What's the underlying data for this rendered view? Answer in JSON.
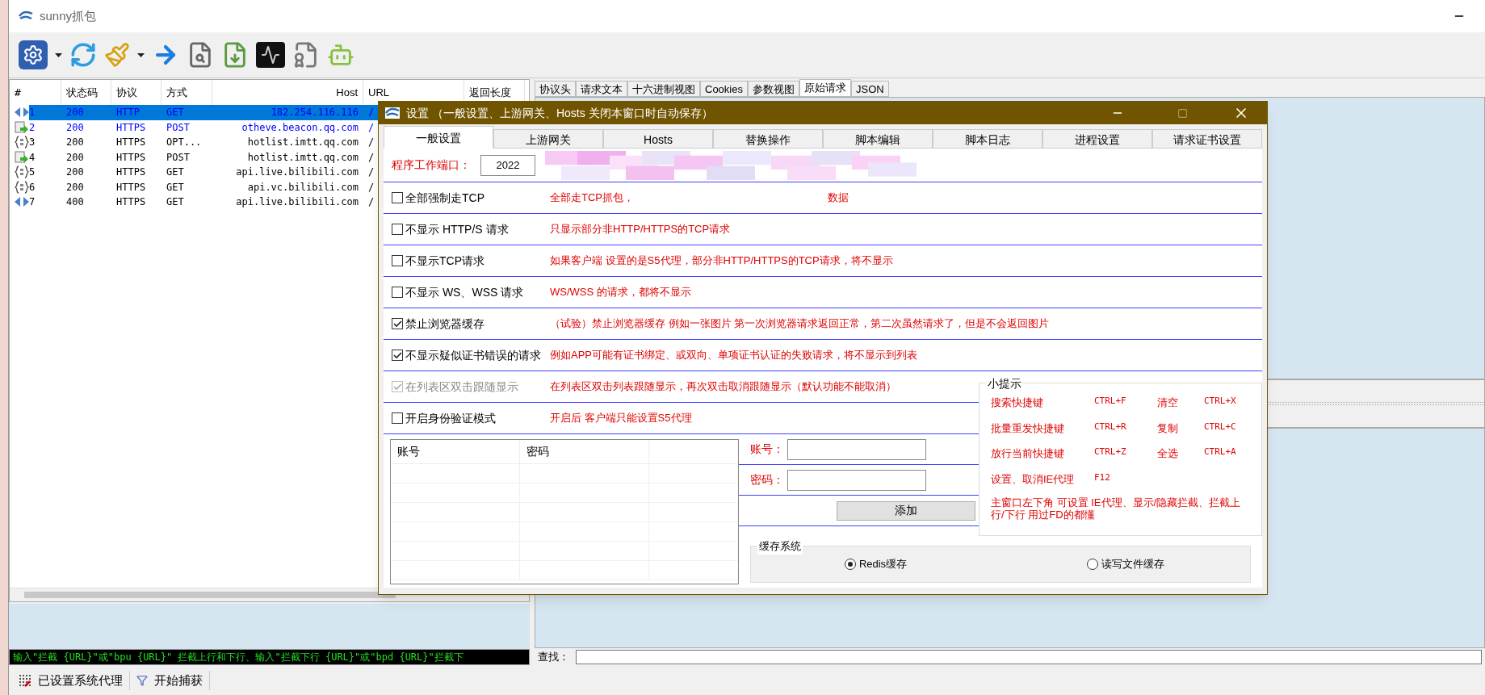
{
  "window": {
    "title": "sunny抓包"
  },
  "list": {
    "columns": [
      "#",
      "状态码",
      "协议",
      "方式",
      "Host",
      "URL",
      "返回长度"
    ],
    "rows": [
      {
        "kind": "websocket",
        "num": "1",
        "status": "200",
        "protocol": "HTTP",
        "method": "GET",
        "host": "182.254.116.116",
        "url": "/",
        "selected": true,
        "highlighted": true
      },
      {
        "kind": "file",
        "num": "2",
        "status": "200",
        "protocol": "HTTPS",
        "method": "POST",
        "host": "otheve.beacon.qq.com",
        "url": "/",
        "selected": false,
        "highlighted": true
      },
      {
        "kind": "json",
        "num": "3",
        "status": "200",
        "protocol": "HTTPS",
        "method": "OPT...",
        "host": "hotlist.imtt.qq.com",
        "url": "/",
        "selected": false,
        "highlighted": false
      },
      {
        "kind": "file",
        "num": "4",
        "status": "200",
        "protocol": "HTTPS",
        "method": "POST",
        "host": "hotlist.imtt.qq.com",
        "url": "/",
        "selected": false,
        "highlighted": false
      },
      {
        "kind": "json",
        "num": "5",
        "status": "200",
        "protocol": "HTTPS",
        "method": "GET",
        "host": "api.live.bilibili.com",
        "url": "/",
        "selected": false,
        "highlighted": false
      },
      {
        "kind": "json",
        "num": "6",
        "status": "200",
        "protocol": "HTTPS",
        "method": "GET",
        "host": "api.vc.bilibili.com",
        "url": "/",
        "selected": false,
        "highlighted": false
      },
      {
        "kind": "websocket",
        "num": "7",
        "status": "400",
        "protocol": "HTTPS",
        "method": "GET",
        "host": "api.live.bilibili.com",
        "url": "/",
        "selected": false,
        "highlighted": false
      }
    ]
  },
  "detail_tabs": [
    {
      "label": "协议头",
      "selected": false
    },
    {
      "label": "请求文本",
      "selected": false
    },
    {
      "label": "十六进制视图",
      "selected": false
    },
    {
      "label": "Cookies",
      "selected": false
    },
    {
      "label": "参数视图",
      "selected": false
    },
    {
      "label": "原始请求",
      "selected": true
    },
    {
      "label": "JSON",
      "selected": false
    }
  ],
  "command_line": "输入\"拦截 {URL}\"或\"bpu {URL}\" 拦截上行和下行、输入\"拦截下行 {URL}\"或\"bpd {URL}\"拦截下",
  "search": {
    "label": "查找："
  },
  "status_bar": [
    {
      "label": "已设置系统代理"
    },
    {
      "label": "开始捕获"
    }
  ],
  "dialog": {
    "title": "设置 （一般设置、上游网关、Hosts 关闭本窗口时自动保存）",
    "tabs": [
      {
        "label": "一般设置",
        "selected": true
      },
      {
        "label": "上游网关",
        "selected": false
      },
      {
        "label": "Hosts",
        "selected": false
      },
      {
        "label": "替换操作",
        "selected": false
      },
      {
        "label": "脚本编辑",
        "selected": false
      },
      {
        "label": "脚本日志",
        "selected": false
      },
      {
        "label": "进程设置",
        "selected": false
      },
      {
        "label": "请求证书设置",
        "selected": false
      }
    ],
    "port": {
      "label": "程序工作端口：",
      "value": "2022"
    },
    "options": [
      {
        "label": "全部强制走TCP",
        "checked": false,
        "disabled": false,
        "description": "全部走TCP抓包，",
        "description_end": "数据"
      },
      {
        "label": "不显示 HTTP/S 请求",
        "checked": false,
        "disabled": false,
        "description": "只显示部分非HTTP/HTTPS的TCP请求"
      },
      {
        "label": "不显示TCP请求",
        "checked": false,
        "disabled": false,
        "description": "如果客户端 设置的是S5代理，部分非HTTP/HTTPS的TCP请求，将不显示"
      },
      {
        "label": "不显示 WS、WSS 请求",
        "checked": false,
        "disabled": false,
        "description": "WS/WSS 的请求，都将不显示"
      },
      {
        "label": "禁止浏览器缓存",
        "checked": true,
        "disabled": false,
        "description": "（试验）禁止浏览器缓存 例如一张图片 第一次浏览器请求返回正常，第二次虽然请求了，但是不会返回图片"
      },
      {
        "label": "不显示疑似证书错误的请求",
        "checked": true,
        "disabled": false,
        "description": "例如APP可能有证书绑定、或双向、单项证书认证的失败请求，将不显示到列表"
      },
      {
        "label": "在列表区双击跟随显示",
        "checked": true,
        "disabled": true,
        "description": "在列表区双击列表跟随显示，再次双击取消跟随显示（默认功能不能取消）"
      },
      {
        "label": "开启身份验证模式",
        "checked": false,
        "disabled": false,
        "description": "开启后 客户端只能设置S5代理"
      }
    ],
    "accounts": {
      "columns": [
        "账号",
        "密码"
      ]
    },
    "form": {
      "account_label": "账号：",
      "password_label": "密码：",
      "add_button": "添加"
    },
    "tips": {
      "title": "小提示",
      "shortcuts": [
        {
          "action": "搜索快捷键",
          "keys": "CTRL+F"
        },
        {
          "action": "清空",
          "keys": "CTRL+X"
        },
        {
          "action": "批量重发快捷键",
          "keys": "CTRL+R"
        },
        {
          "action": "复制",
          "keys": "CTRL+C"
        },
        {
          "action": "放行当前快捷键",
          "keys": "CTRL+Z"
        },
        {
          "action": "全选",
          "keys": "CTRL+A"
        },
        {
          "action": "设置、取消IE代理",
          "keys": "F12"
        }
      ],
      "note": "主窗口左下角 可设置 IE代理、显示/隐藏拦截、拦截上行/下行 用过FD的都懂"
    },
    "cache": {
      "title": "缓存系统",
      "options": [
        {
          "label": "Redis缓存",
          "selected": true
        },
        {
          "label": "读写文件缓存",
          "selected": false
        }
      ]
    }
  }
}
